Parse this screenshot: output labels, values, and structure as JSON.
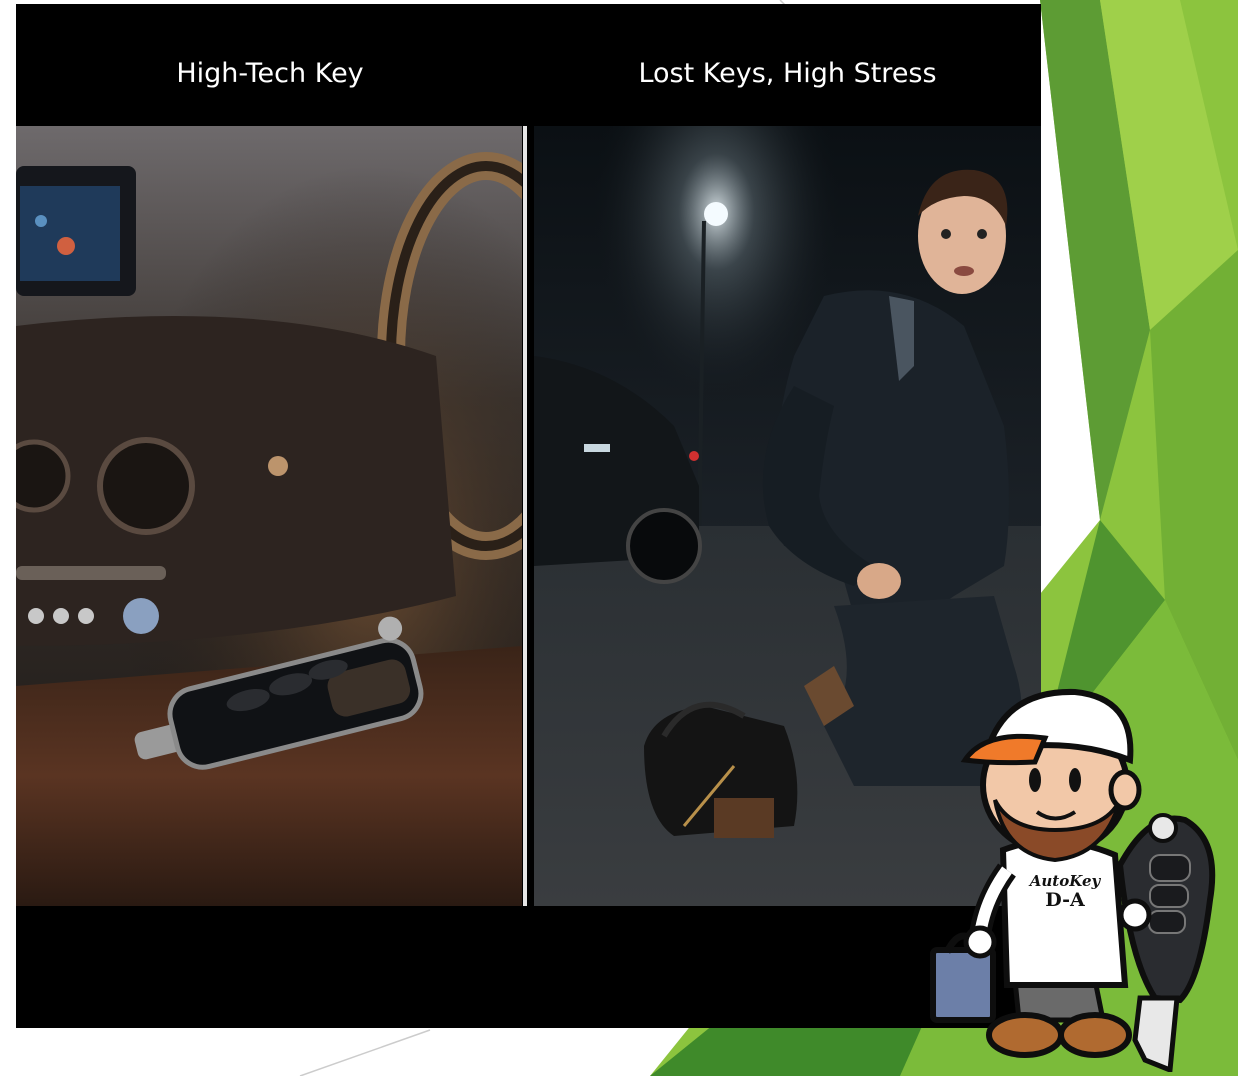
{
  "slide": {
    "left_title": "High-Tech Key",
    "right_title": "Lost Keys, High Stress"
  },
  "mascot": {
    "brand_line1": "AutoKey",
    "brand_line2": "D-A"
  },
  "colors": {
    "accent_green_light": "#8cc43e",
    "accent_green_dark": "#3f8a2a",
    "panel_background": "#000000",
    "divider": "#e6e6e6",
    "cap_orange": "#f07a2a"
  }
}
